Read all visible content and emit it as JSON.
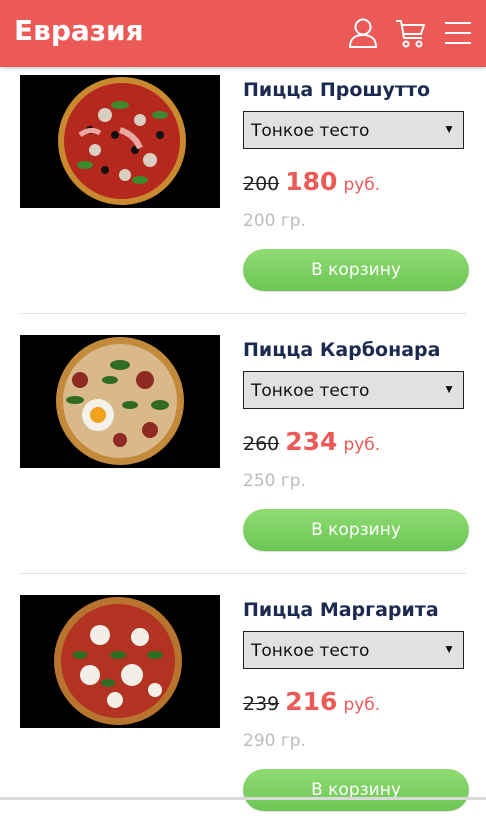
{
  "header": {
    "brand": "Евразия",
    "background": "#ec5a57",
    "icons": [
      "user-icon",
      "cart-icon",
      "menu-icon"
    ]
  },
  "products": [
    {
      "name": "Пицца Прошутто",
      "dough": "Тонкое тесто",
      "old_price": "200",
      "price": "180",
      "currency": "руб.",
      "weight": "200 гр.",
      "button": "В корзину"
    },
    {
      "name": "Пицца Карбонара",
      "dough": "Тонкое тесто",
      "old_price": "260",
      "price": "234",
      "currency": "руб.",
      "weight": "250 гр.",
      "button": "В корзину"
    },
    {
      "name": "Пицца Маргарита",
      "dough": "Тонкое тесто",
      "old_price": "239",
      "price": "216",
      "currency": "руб.",
      "weight": "290 гр.",
      "button": "В корзину"
    }
  ],
  "colors": {
    "accent": "#ec5a57",
    "button_green": "#7ad162",
    "title_navy": "#1d2a4f",
    "weight_gray": "#bcbcbc"
  }
}
